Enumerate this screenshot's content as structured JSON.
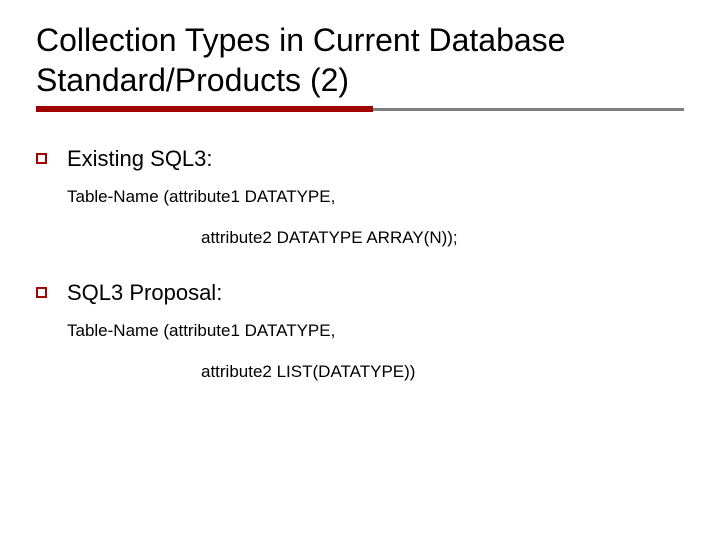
{
  "title": "Collection Types in Current Database Standard/Products (2)",
  "sections": [
    {
      "heading": "Existing SQL3:",
      "code": {
        "line1": "Table-Name (attribute1  DATATYPE,",
        "line2": "attribute2 DATATYPE  ARRAY(N));"
      }
    },
    {
      "heading": "SQL3 Proposal:",
      "code": {
        "line1": "Table-Name (attribute1  DATATYPE,",
        "line2": "attribute2 LIST(DATATYPE))"
      }
    }
  ]
}
